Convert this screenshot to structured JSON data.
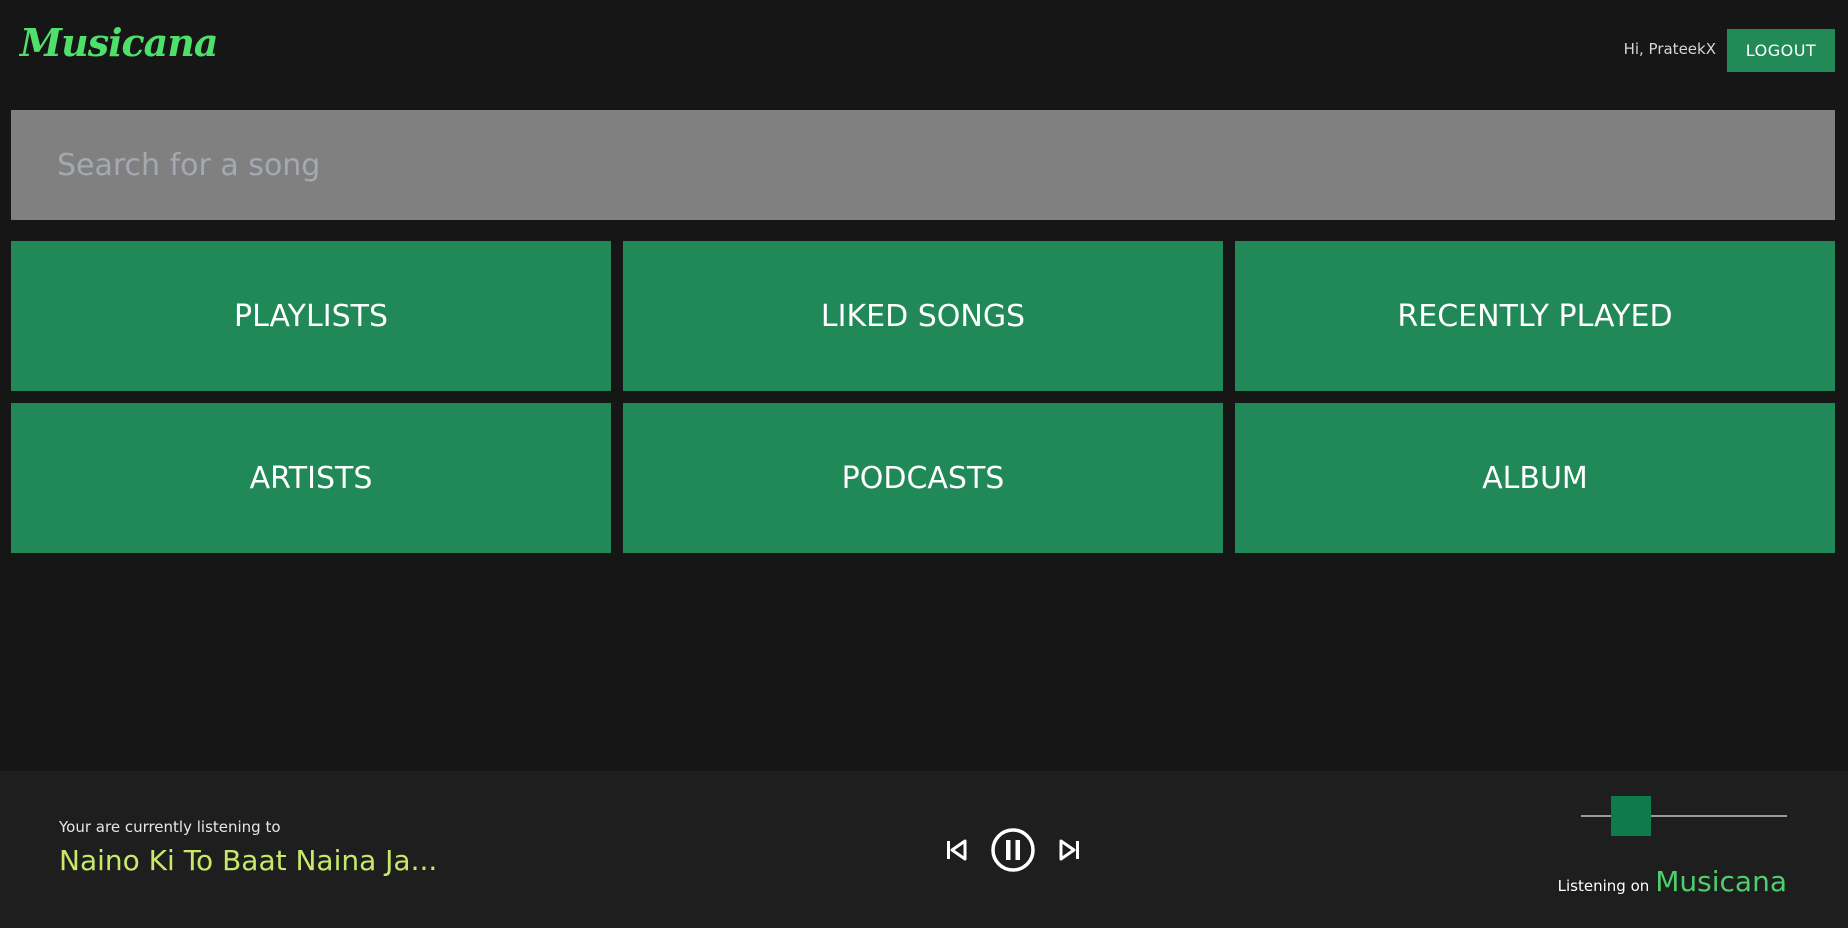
{
  "header": {
    "logo": "Musicana",
    "greeting": "Hi, PrateekX",
    "logout_label": "LOGOUT"
  },
  "search": {
    "placeholder": "Search for a song",
    "value": ""
  },
  "categories": [
    {
      "label": "PLAYLISTS"
    },
    {
      "label": "LIKED SONGS"
    },
    {
      "label": "RECENTLY PLAYED"
    },
    {
      "label": "ARTISTS"
    },
    {
      "label": "PODCASTS"
    },
    {
      "label": "ALBUM"
    }
  ],
  "player": {
    "now_label": "Your are currently listening to",
    "track_title": "Naino Ki To Baat Naina Ja...",
    "controls": {
      "previous_icon": "skip-previous-icon",
      "play_state_icon": "pause-icon",
      "next_icon": "skip-next-icon"
    },
    "volume_level": 0.18,
    "brand_prefix": "Listening on",
    "brand_name": "Musicana"
  },
  "colors": {
    "background": "#161616",
    "accent_green": "#218858",
    "logo_green": "#4ee06a",
    "track_title_color": "#c9e86a",
    "search_bg": "#808080",
    "player_bg": "#1e1e1e"
  }
}
